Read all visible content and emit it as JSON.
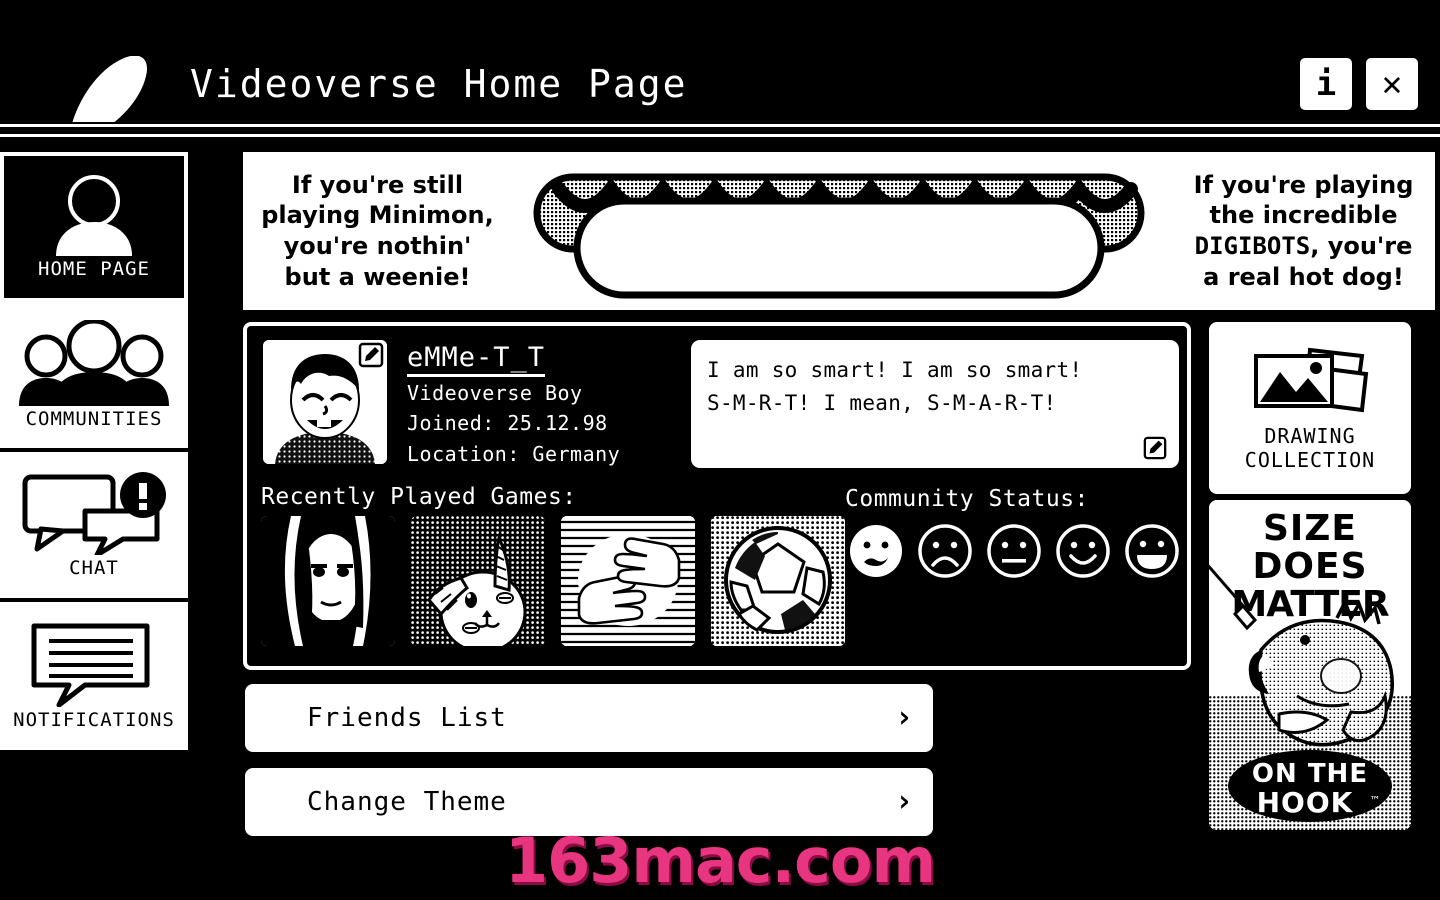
{
  "window": {
    "title": "Videoverse Home Page",
    "logo_icon": "wave-logo-icon",
    "buttons": [
      {
        "name": "info-button",
        "label": "i",
        "icon": "info-icon"
      },
      {
        "name": "close-button",
        "label": "✕",
        "icon": "close-icon"
      }
    ]
  },
  "sidebar": {
    "items": [
      {
        "label": "HOME PAGE",
        "icon": "person-icon",
        "active": true
      },
      {
        "label": "COMMUNITIES",
        "icon": "people-group-icon",
        "active": false
      },
      {
        "label": "CHAT",
        "icon": "chat-bubbles-icon",
        "active": false
      },
      {
        "label": "NOTIFICATIONS",
        "icon": "notification-note-icon",
        "active": false
      }
    ]
  },
  "banner": {
    "left_text": "If you're still playing Minimon, you're nothin' but a weenie!",
    "left_lines": [
      "If you're still",
      "playing Minimon,",
      "you're nothin'",
      "but a weenie!"
    ],
    "right_lines_1": "If you're playing",
    "right_lines_2": "the incredible",
    "right_brand": "DIGIBOTS",
    "right_lines_3": ", you're",
    "right_lines_4": "a real hot dog!",
    "illustration": "hot-dog-icon"
  },
  "profile": {
    "avatar_icon": "user-avatar-photo",
    "avatar_edit_icon": "edit-pencil-icon",
    "username": "eMMe-T_T",
    "subtitle": "Videoverse Boy",
    "joined": "Joined: 25.12.98",
    "location": "Location: Germany",
    "status": {
      "line1": "I am so smart! I am so smart!",
      "line2": "S-M-R-T! I mean, S-M-A-R-T!",
      "edit_icon": "edit-pencil-icon"
    },
    "games_label": "Recently Played Games:",
    "games": [
      {
        "name": "game-thumb-horror-face",
        "alt": "horror anime face"
      },
      {
        "name": "game-thumb-bunny",
        "alt": "bunny creature"
      },
      {
        "name": "game-thumb-hands",
        "alt": "clapping hands"
      },
      {
        "name": "game-thumb-soccer",
        "alt": "soccer ball"
      }
    ],
    "community_status_label": "Community Status:",
    "faces": [
      {
        "name": "face-worried",
        "selected": true
      },
      {
        "name": "face-sad",
        "selected": false
      },
      {
        "name": "face-neutral",
        "selected": false
      },
      {
        "name": "face-smile",
        "selected": false
      },
      {
        "name": "face-grin",
        "selected": false
      }
    ]
  },
  "actions": [
    {
      "label": "Friends List",
      "chevron": "›",
      "name": "friends-list-button"
    },
    {
      "label": "Change Theme",
      "chevron": "›",
      "name": "change-theme-button"
    }
  ],
  "right_rail": {
    "drawing": {
      "icon": "pictures-stack-icon",
      "label_line1": "DRAWING",
      "label_line2": "COLLECTION"
    },
    "ad": {
      "headline_1": "SIZE",
      "headline_2": "DOES",
      "headline_3": "MATTER",
      "logo_line1": "ON THE",
      "logo_line2": "HOOK",
      "trademark": "™",
      "art": "fish-on-hook-icon"
    }
  },
  "watermark": {
    "text": "163mac.com",
    "color": "#E8357F"
  }
}
